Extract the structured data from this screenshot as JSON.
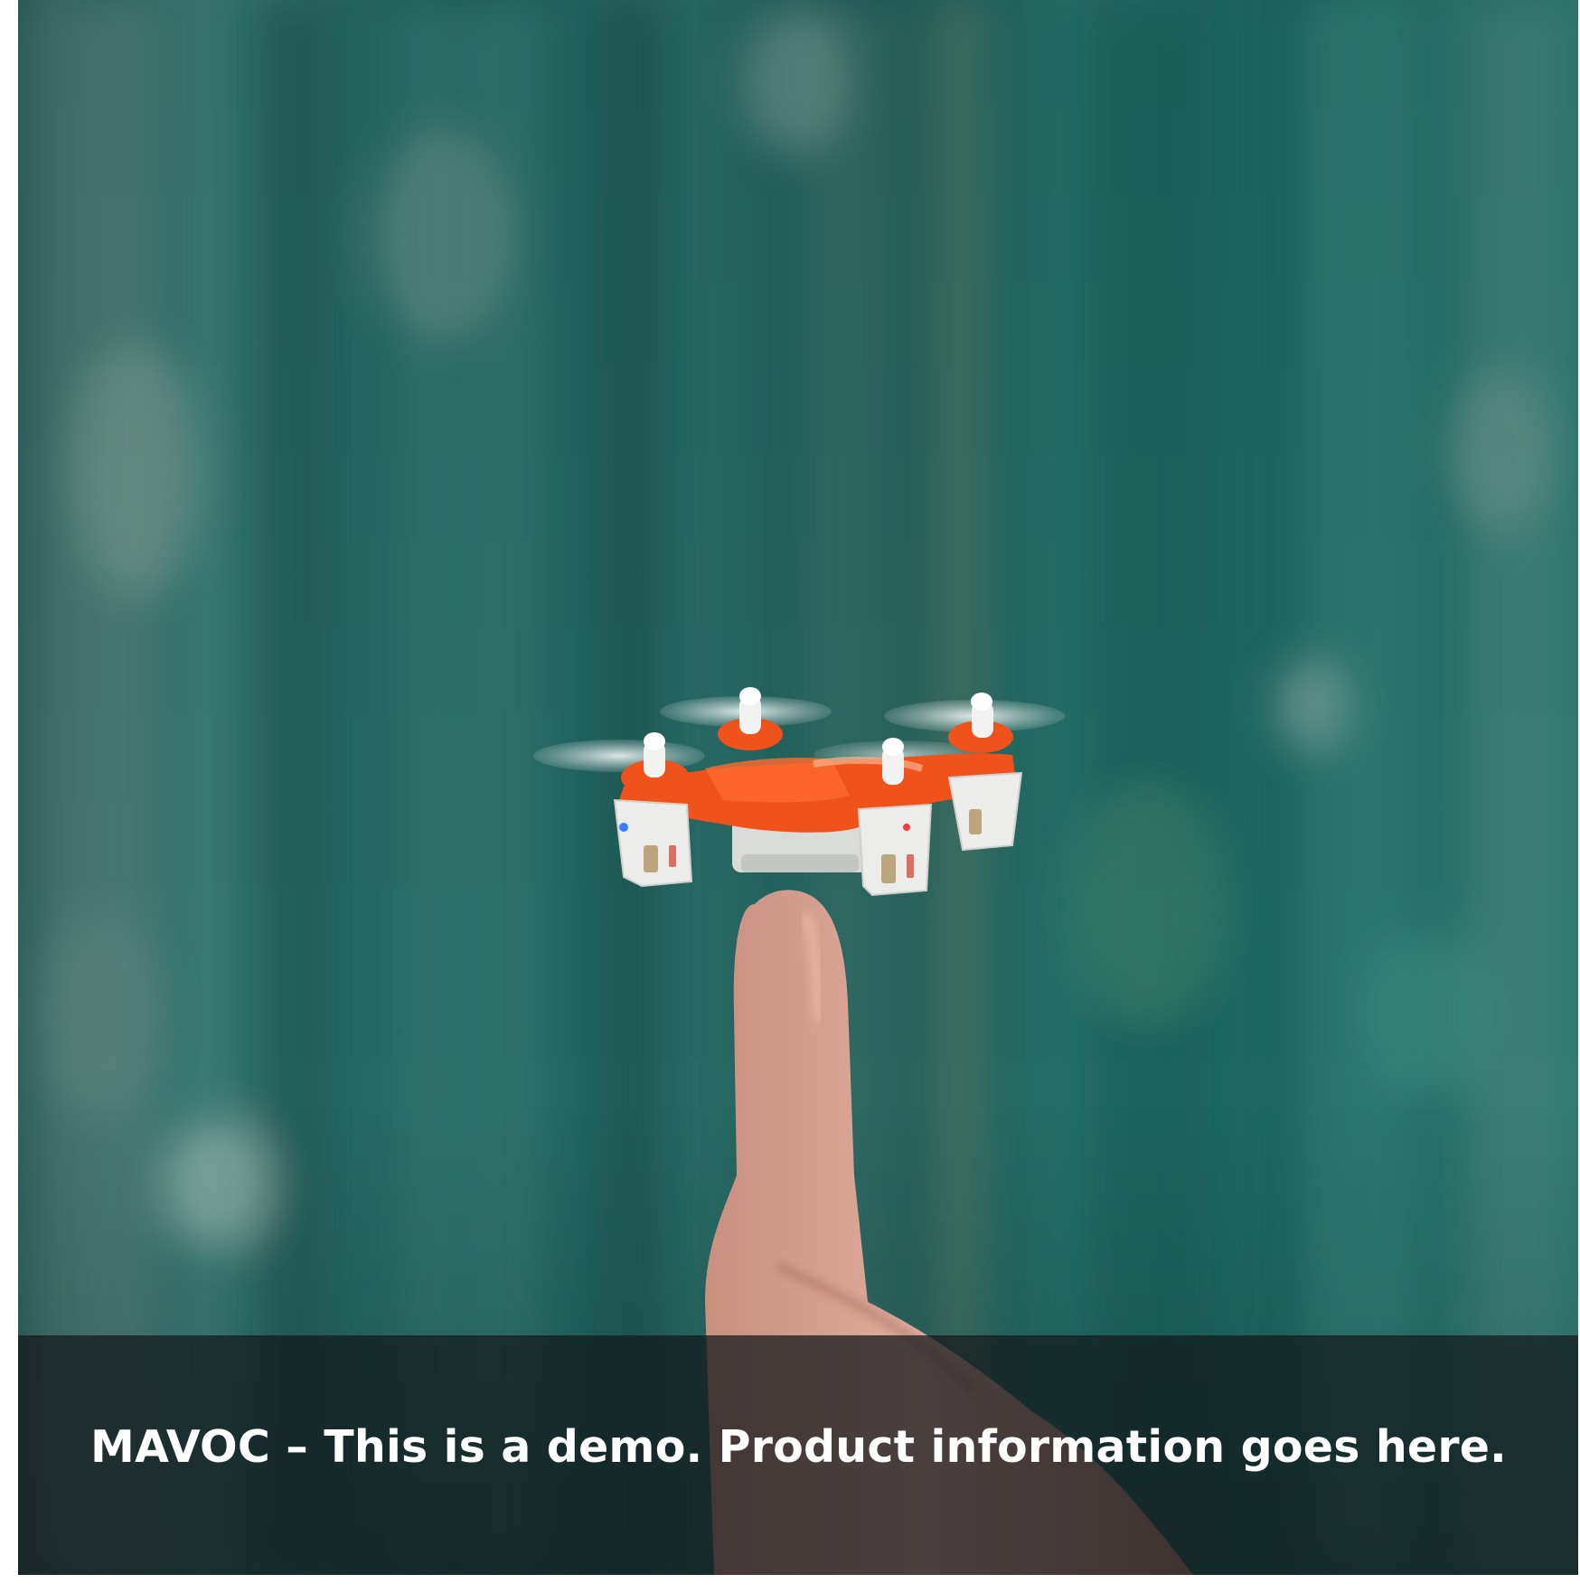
{
  "caption": {
    "text": "MAVOC – This is a demo. Product information goes here."
  },
  "colors": {
    "background_teal": "#1f5e5b",
    "background_teal_light": "#3e8a84",
    "drone_orange": "#f0521c",
    "drone_white": "#e8e8e6",
    "caption_overlay": "#141a1c",
    "caption_text": "#ffffff"
  },
  "icons": [
    "drone-image",
    "finger-image"
  ]
}
